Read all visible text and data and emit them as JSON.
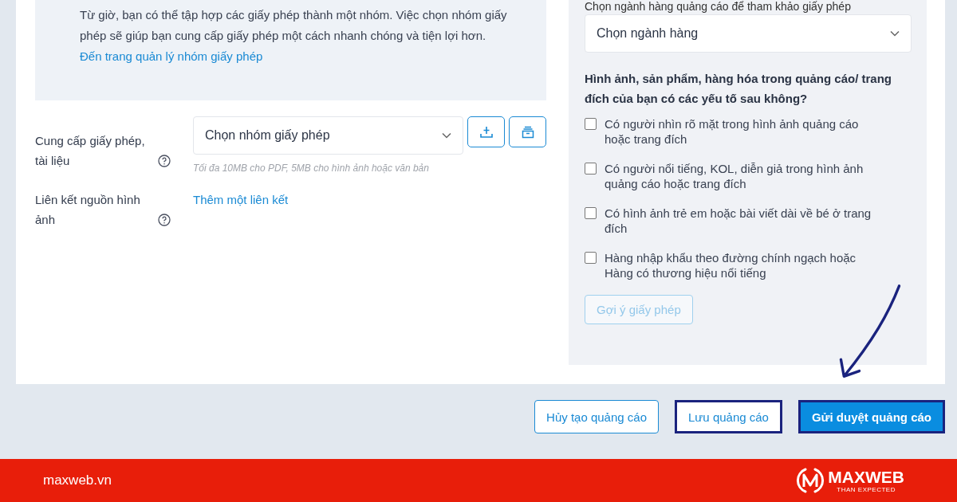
{
  "info_box": {
    "text": "Từ giờ, bạn có thể tập hợp các giấy phép thành một nhóm. Việc chọn nhóm giấy phép sẽ giúp bạn cung cấp giấy phép một cách nhanh chóng và tiện lợi hơn.",
    "link": "Đến trang quản lý nhóm giấy phép"
  },
  "license_row": {
    "label": "Cung cấp giấy phép, tài liệu",
    "select": "Chọn nhóm giấy phép",
    "hint": "Tối đa 10MB cho PDF, 5MB cho hình ảnh hoặc văn bản"
  },
  "link_row": {
    "label": "Liên kết nguồn hình ảnh",
    "link": "Thêm một liên kết"
  },
  "right_panel": {
    "heading": "Chọn ngành hàng quảng cáo để tham khảo giấy phép",
    "select": "Chọn ngành hàng",
    "question": "Hình ảnh, sản phẩm, hàng hóa trong quảng cáo/ trang đích của bạn có các yếu tố sau không?",
    "options": [
      {
        "label": "Có người nhìn rõ mặt trong hình ảnh quảng cáo hoặc trang đích",
        "checked": false
      },
      {
        "label": "Có người nổi tiếng, KOL, diễn giả trong hình ảnh quảng cáo hoặc trang đích",
        "checked": false
      },
      {
        "label": "Có hình ảnh trẻ em hoặc bài viết dài về bé ở trang đích",
        "checked": false
      },
      {
        "label": "Hàng nhập khẩu theo đường chính ngạch hoặc Hàng có thương hiệu nổi tiếng",
        "checked": false
      }
    ],
    "suggest_button": {
      "label": "Gợi ý giấy phép",
      "disabled": true
    }
  },
  "actions": [
    {
      "label": "Hủy tạo quảng cáo",
      "kind": "outline",
      "highlighted": false
    },
    {
      "label": "Lưu quảng cáo",
      "kind": "outline",
      "highlighted": true
    },
    {
      "label": "Gửi duyệt quảng cáo",
      "kind": "primary",
      "highlighted": true
    }
  ],
  "footer": {
    "site": "maxweb.vn",
    "brand": "MAXWEB",
    "tagline": "THAN EXPECTED"
  }
}
